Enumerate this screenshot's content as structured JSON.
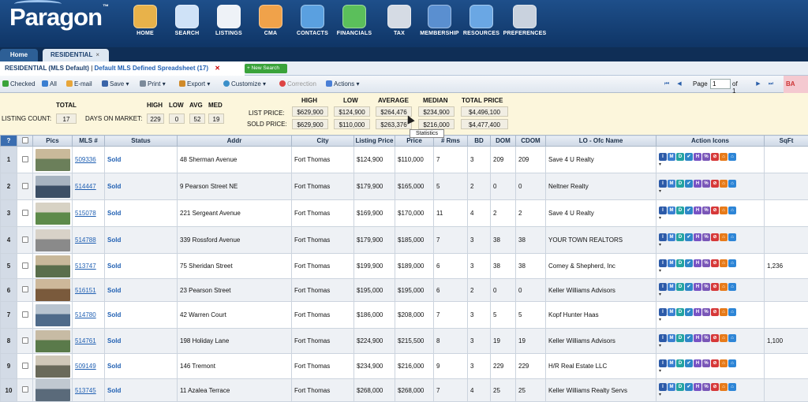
{
  "app": {
    "logo": "Paragon",
    "logo_mark": "™"
  },
  "nav": [
    {
      "label": "HOME",
      "icon": "house-icon",
      "color": "#e8b24a"
    },
    {
      "label": "SEARCH",
      "icon": "magnifier-document-icon",
      "color": "#cfe2f7"
    },
    {
      "label": "LISTINGS",
      "icon": "document-list-icon",
      "color": "#eef2f7"
    },
    {
      "label": "CMA",
      "icon": "chart-document-icon",
      "color": "#f0a24a"
    },
    {
      "label": "CONTACTS",
      "icon": "people-icon",
      "color": "#5aa0e0"
    },
    {
      "label": "FINANCIALS",
      "icon": "pie-chart-icon",
      "color": "#5bbf5b"
    },
    {
      "label": "TAX",
      "icon": "coins-icon",
      "color": "#d5dbe4"
    },
    {
      "label": "MEMBERSHIP",
      "icon": "monitor-globe-icon",
      "color": "#5a8fd0"
    },
    {
      "label": "RESOURCES",
      "icon": "book-stack-icon",
      "color": "#6aa7e4"
    },
    {
      "label": "PREFERENCES",
      "icon": "wrench-screwdriver-icon",
      "color": "#c9d2de"
    }
  ],
  "tabs": {
    "home": "Home",
    "residential": "RESIDENTIAL",
    "close": "×"
  },
  "subtab": {
    "title": "RESIDENTIAL (MLS Default)",
    "separator": "|",
    "spreadsheet": "Default MLS Defined Spreadsheet (17)",
    "close": "✕",
    "new_search": "+ New Search"
  },
  "toolbar": {
    "checked": "Checked",
    "all": "All",
    "email": "E-mail",
    "save": "Save",
    "print": "Print",
    "export": "Export",
    "customize": "Customize",
    "correction": "Correction",
    "actions": "Actions",
    "caret": "▾"
  },
  "pager": {
    "first": "⏮",
    "prev": "◀",
    "page_label": "Page",
    "page_value": "1",
    "of": "of 1",
    "next": "▶",
    "last": "⏭",
    "back": "BA"
  },
  "stats": {
    "total_label": "TOTAL",
    "listing_count_label": "LISTING COUNT:",
    "listing_count": "17",
    "dom_label": "DAYS ON MARKET:",
    "high_label": "HIGH",
    "low_label": "LOW",
    "avg_label": "AVG",
    "med_label": "MED",
    "dom_high": "229",
    "dom_low": "0",
    "dom_avg": "52",
    "dom_med": "19",
    "list_price_label": "LIST PRICE:",
    "sold_price_label": "SOLD PRICE:",
    "price_high_label": "HIGH",
    "price_low_label": "LOW",
    "price_avg_label": "AVERAGE",
    "price_med_label": "MEDIAN",
    "price_total_label": "TOTAL PRICE",
    "list": {
      "high": "$629,900",
      "low": "$124,900",
      "avg": "$264,476",
      "med": "$234,900",
      "total": "$4,496,100"
    },
    "sold": {
      "high": "$629,900",
      "low": "$110,000",
      "avg": "$263,376",
      "med": "$216,000",
      "total": "$4,477,400"
    },
    "tooltip": "Statistics"
  },
  "table": {
    "headers": [
      "?",
      "",
      "Pics",
      "MLS #",
      "Status",
      "Addr",
      "City",
      "Listing Price",
      "Price",
      "# Rms",
      "BD",
      "DOM",
      "CDOM",
      "LO - Ofc Name",
      "Action Icons",
      "SqFt"
    ],
    "rows": [
      {
        "n": "1",
        "mls": "509336",
        "status": "Sold",
        "addr": "48 Sherman Avenue",
        "city": "Fort Thomas",
        "list": "$124,900",
        "price": "$110,000",
        "rms": "7",
        "bd": "3",
        "dom": "209",
        "cdom": "209",
        "office": "Save 4 U Realty",
        "sqft": ""
      },
      {
        "n": "2",
        "mls": "514447",
        "status": "Sold",
        "addr": "9 Pearson Street NE",
        "city": "Fort Thomas",
        "list": "$179,900",
        "price": "$165,000",
        "rms": "5",
        "bd": "2",
        "dom": "0",
        "cdom": "0",
        "office": "Neltner Realty",
        "sqft": ""
      },
      {
        "n": "3",
        "mls": "515078",
        "status": "Sold",
        "addr": "221 Sergeant Avenue",
        "city": "Fort Thomas",
        "list": "$169,900",
        "price": "$170,000",
        "rms": "11",
        "bd": "4",
        "dom": "2",
        "cdom": "2",
        "office": "Save 4 U Realty",
        "sqft": ""
      },
      {
        "n": "4",
        "mls": "514788",
        "status": "Sold",
        "addr": "339 Rossford Avenue",
        "city": "Fort Thomas",
        "list": "$179,900",
        "price": "$185,000",
        "rms": "7",
        "bd": "3",
        "dom": "38",
        "cdom": "38",
        "office": "YOUR TOWN REALTORS",
        "sqft": ""
      },
      {
        "n": "5",
        "mls": "513747",
        "status": "Sold",
        "addr": "75 Sheridan Street",
        "city": "Fort Thomas",
        "list": "$199,900",
        "price": "$189,000",
        "rms": "6",
        "bd": "3",
        "dom": "38",
        "cdom": "38",
        "office": "Comey & Shepherd, Inc",
        "sqft": "1,236"
      },
      {
        "n": "6",
        "mls": "516151",
        "status": "Sold",
        "addr": "23 Pearson Street",
        "city": "Fort Thomas",
        "list": "$195,000",
        "price": "$195,000",
        "rms": "6",
        "bd": "2",
        "dom": "0",
        "cdom": "0",
        "office": "Keller Williams Advisors",
        "sqft": ""
      },
      {
        "n": "7",
        "mls": "514780",
        "status": "Sold",
        "addr": "42 Warren Court",
        "city": "Fort Thomas",
        "list": "$186,000",
        "price": "$208,000",
        "rms": "7",
        "bd": "3",
        "dom": "5",
        "cdom": "5",
        "office": "Kopf Hunter Haas",
        "sqft": ""
      },
      {
        "n": "8",
        "mls": "514761",
        "status": "Sold",
        "addr": "198 Holiday Lane",
        "city": "Fort Thomas",
        "list": "$224,900",
        "price": "$215,500",
        "rms": "8",
        "bd": "3",
        "dom": "19",
        "cdom": "19",
        "office": "Keller Williams Advisors",
        "sqft": "1,100"
      },
      {
        "n": "9",
        "mls": "509149",
        "status": "Sold",
        "addr": "146 Tremont",
        "city": "Fort Thomas",
        "list": "$234,900",
        "price": "$216,000",
        "rms": "9",
        "bd": "3",
        "dom": "229",
        "cdom": "229",
        "office": "H/R Real Estate LLC",
        "sqft": ""
      },
      {
        "n": "10",
        "mls": "513745",
        "status": "Sold",
        "addr": "11 Azalea Terrace",
        "city": "Fort Thomas",
        "list": "$268,000",
        "price": "$268,000",
        "rms": "7",
        "bd": "4",
        "dom": "25",
        "cdom": "25",
        "office": "Keller Williams Realty Servs",
        "sqft": ""
      }
    ],
    "action_icons": [
      "I",
      "M",
      "D",
      "✔",
      "H",
      "%",
      "⊘",
      "⌂",
      "⌂"
    ],
    "action_dropdown": "▾"
  },
  "colors": {
    "brand_blue": "#1b4f8e",
    "link_blue": "#1f5fb2",
    "stats_bg": "#fcf6dc"
  }
}
